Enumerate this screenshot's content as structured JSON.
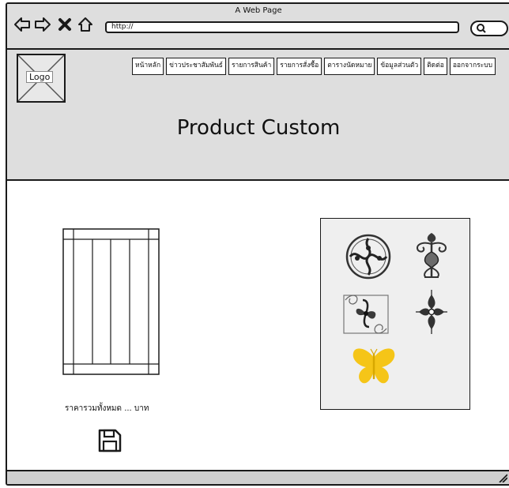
{
  "window": {
    "title": "A Web Page",
    "url": "http://"
  },
  "icons": {
    "back": "arrow-left-icon",
    "forward": "arrow-right-icon",
    "stop": "close-icon",
    "home": "home-icon",
    "search": "search-icon",
    "save": "save-icon",
    "resize": "resize-grip-icon"
  },
  "header": {
    "logo_label": "Logo",
    "menu": [
      "หน้าหลัก",
      "ข่าวประชาสัมพันธ์",
      "รายการสินค้า",
      "รายการสั่งซื้อ",
      "ตารางนัดหมาย",
      "ข้อมูลส่วนตัว",
      "ติดต่อ",
      "ออกจากระบบ"
    ],
    "page_title": "Product Custom"
  },
  "content": {
    "price_text": "ราคารวมทั้งหมด ... บาท",
    "patterns": [
      "circle-scroll-ornament",
      "vertical-scroll-ornament",
      "square-swirl-ornament",
      "diamond-ornament",
      "butterfly-ornament"
    ]
  },
  "colors": {
    "chrome": "#dedede",
    "panel": "#efefef",
    "butterfly": "#f5c518",
    "ink": "#1a1a1a"
  }
}
